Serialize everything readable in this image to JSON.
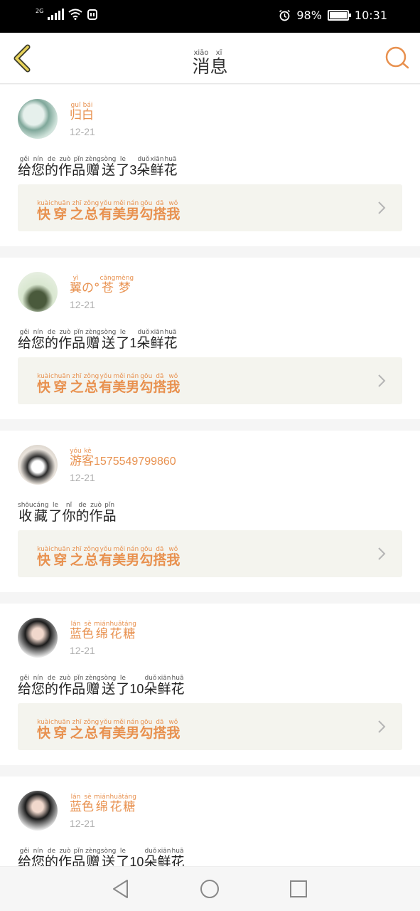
{
  "status": {
    "network": "2G",
    "battery": "98%",
    "battery_level": 0.98,
    "time": "10:31"
  },
  "header": {
    "title": [
      {
        "hz": "消",
        "py": "xiāo"
      },
      {
        "hz": "息",
        "py": "xī"
      }
    ],
    "back_icon": "chevron-left-icon",
    "search_icon": "search-icon",
    "accent": "#e8914f"
  },
  "items": [
    {
      "name": [
        {
          "hz": "归",
          "py": "guī"
        },
        {
          "hz": "白",
          "py": "bái"
        }
      ],
      "date": "12-21",
      "message": [
        {
          "hz": "给",
          "py": "gěi"
        },
        {
          "hz": "您",
          "py": "nín"
        },
        {
          "hz": "的",
          "py": "de"
        },
        {
          "hz": "作",
          "py": "zuò"
        },
        {
          "hz": "品",
          "py": "pǐn"
        },
        {
          "hz": "赠",
          "py": "zèng"
        },
        {
          "hz": "送",
          "py": "sòng"
        },
        {
          "hz": "了",
          "py": "le"
        },
        {
          "num": "3"
        },
        {
          "hz": "朵",
          "py": "duǒ"
        },
        {
          "hz": "鲜",
          "py": "xiān"
        },
        {
          "hz": "花",
          "py": "huā"
        }
      ],
      "work": [
        {
          "hz": "快",
          "py": "kuài"
        },
        {
          "hz": "穿",
          "py": "chuān"
        },
        {
          "hz": "之",
          "py": "zhī"
        },
        {
          "hz": "总",
          "py": "zǒng"
        },
        {
          "hz": "有",
          "py": "yǒu"
        },
        {
          "hz": "美",
          "py": "měi"
        },
        {
          "hz": "男",
          "py": "nán"
        },
        {
          "hz": "勾",
          "py": "gōu"
        },
        {
          "hz": "搭",
          "py": "dā"
        },
        {
          "hz": "我",
          "py": "wǒ"
        }
      ]
    },
    {
      "name": [
        {
          "hz": "翼",
          "py": "yì"
        },
        {
          "hz": "の",
          "py": ""
        },
        {
          "hz": "°",
          "py": ""
        },
        {
          "hz": "苍",
          "py": "cāng"
        },
        {
          "hz": "梦",
          "py": "mèng"
        }
      ],
      "date": "12-21",
      "message": [
        {
          "hz": "给",
          "py": "gěi"
        },
        {
          "hz": "您",
          "py": "nín"
        },
        {
          "hz": "的",
          "py": "de"
        },
        {
          "hz": "作",
          "py": "zuò"
        },
        {
          "hz": "品",
          "py": "pǐn"
        },
        {
          "hz": "赠",
          "py": "zèng"
        },
        {
          "hz": "送",
          "py": "sòng"
        },
        {
          "hz": "了",
          "py": "le"
        },
        {
          "num": "1"
        },
        {
          "hz": "朵",
          "py": "duǒ"
        },
        {
          "hz": "鲜",
          "py": "xiān"
        },
        {
          "hz": "花",
          "py": "huā"
        }
      ],
      "work": [
        {
          "hz": "快",
          "py": "kuài"
        },
        {
          "hz": "穿",
          "py": "chuān"
        },
        {
          "hz": "之",
          "py": "zhī"
        },
        {
          "hz": "总",
          "py": "zǒng"
        },
        {
          "hz": "有",
          "py": "yǒu"
        },
        {
          "hz": "美",
          "py": "měi"
        },
        {
          "hz": "男",
          "py": "nán"
        },
        {
          "hz": "勾",
          "py": "gōu"
        },
        {
          "hz": "搭",
          "py": "dā"
        },
        {
          "hz": "我",
          "py": "wǒ"
        }
      ]
    },
    {
      "name": [
        {
          "hz": "游",
          "py": "yóu"
        },
        {
          "hz": "客",
          "py": "kè"
        },
        {
          "num": "1575549799860"
        }
      ],
      "date": "12-21",
      "message": [
        {
          "hz": "收",
          "py": "shōu"
        },
        {
          "hz": "藏",
          "py": "cáng"
        },
        {
          "hz": "了",
          "py": "le"
        },
        {
          "hz": "你",
          "py": "nǐ"
        },
        {
          "hz": "的",
          "py": "de"
        },
        {
          "hz": "作",
          "py": "zuò"
        },
        {
          "hz": "品",
          "py": "pǐn"
        }
      ],
      "work": [
        {
          "hz": "快",
          "py": "kuài"
        },
        {
          "hz": "穿",
          "py": "chuān"
        },
        {
          "hz": "之",
          "py": "zhī"
        },
        {
          "hz": "总",
          "py": "zǒng"
        },
        {
          "hz": "有",
          "py": "yǒu"
        },
        {
          "hz": "美",
          "py": "měi"
        },
        {
          "hz": "男",
          "py": "nán"
        },
        {
          "hz": "勾",
          "py": "gōu"
        },
        {
          "hz": "搭",
          "py": "dā"
        },
        {
          "hz": "我",
          "py": "wǒ"
        }
      ]
    },
    {
      "name": [
        {
          "hz": "蓝",
          "py": "lán"
        },
        {
          "hz": "色",
          "py": "sè"
        },
        {
          "hz": "绵",
          "py": "mián"
        },
        {
          "hz": "花",
          "py": "huā"
        },
        {
          "hz": "糖",
          "py": "táng"
        }
      ],
      "date": "12-21",
      "message": [
        {
          "hz": "给",
          "py": "gěi"
        },
        {
          "hz": "您",
          "py": "nín"
        },
        {
          "hz": "的",
          "py": "de"
        },
        {
          "hz": "作",
          "py": "zuò"
        },
        {
          "hz": "品",
          "py": "pǐn"
        },
        {
          "hz": "赠",
          "py": "zèng"
        },
        {
          "hz": "送",
          "py": "sòng"
        },
        {
          "hz": "了",
          "py": "le"
        },
        {
          "num": "10"
        },
        {
          "hz": "朵",
          "py": "duǒ"
        },
        {
          "hz": "鲜",
          "py": "xiān"
        },
        {
          "hz": "花",
          "py": "huā"
        }
      ],
      "work": [
        {
          "hz": "快",
          "py": "kuài"
        },
        {
          "hz": "穿",
          "py": "chuān"
        },
        {
          "hz": "之",
          "py": "zhī"
        },
        {
          "hz": "总",
          "py": "zǒng"
        },
        {
          "hz": "有",
          "py": "yǒu"
        },
        {
          "hz": "美",
          "py": "měi"
        },
        {
          "hz": "男",
          "py": "nán"
        },
        {
          "hz": "勾",
          "py": "gōu"
        },
        {
          "hz": "搭",
          "py": "dā"
        },
        {
          "hz": "我",
          "py": "wǒ"
        }
      ]
    },
    {
      "name": [
        {
          "hz": "蓝",
          "py": "lán"
        },
        {
          "hz": "色",
          "py": "sè"
        },
        {
          "hz": "绵",
          "py": "mián"
        },
        {
          "hz": "花",
          "py": "huā"
        },
        {
          "hz": "糖",
          "py": "táng"
        }
      ],
      "date": "12-21",
      "message": [
        {
          "hz": "给",
          "py": "gěi"
        },
        {
          "hz": "您",
          "py": "nín"
        },
        {
          "hz": "的",
          "py": "de"
        },
        {
          "hz": "作",
          "py": "zuò"
        },
        {
          "hz": "品",
          "py": "pǐn"
        },
        {
          "hz": "赠",
          "py": "zèng"
        },
        {
          "hz": "送",
          "py": "sòng"
        },
        {
          "hz": "了",
          "py": "le"
        },
        {
          "num": "10"
        },
        {
          "hz": "朵",
          "py": "duǒ"
        },
        {
          "hz": "鲜",
          "py": "xiān"
        },
        {
          "hz": "花",
          "py": "huā"
        }
      ],
      "work": []
    }
  ],
  "nav": {
    "back_icon": "triangle-back-icon",
    "home_icon": "circle-home-icon",
    "recents_icon": "square-recents-icon"
  }
}
